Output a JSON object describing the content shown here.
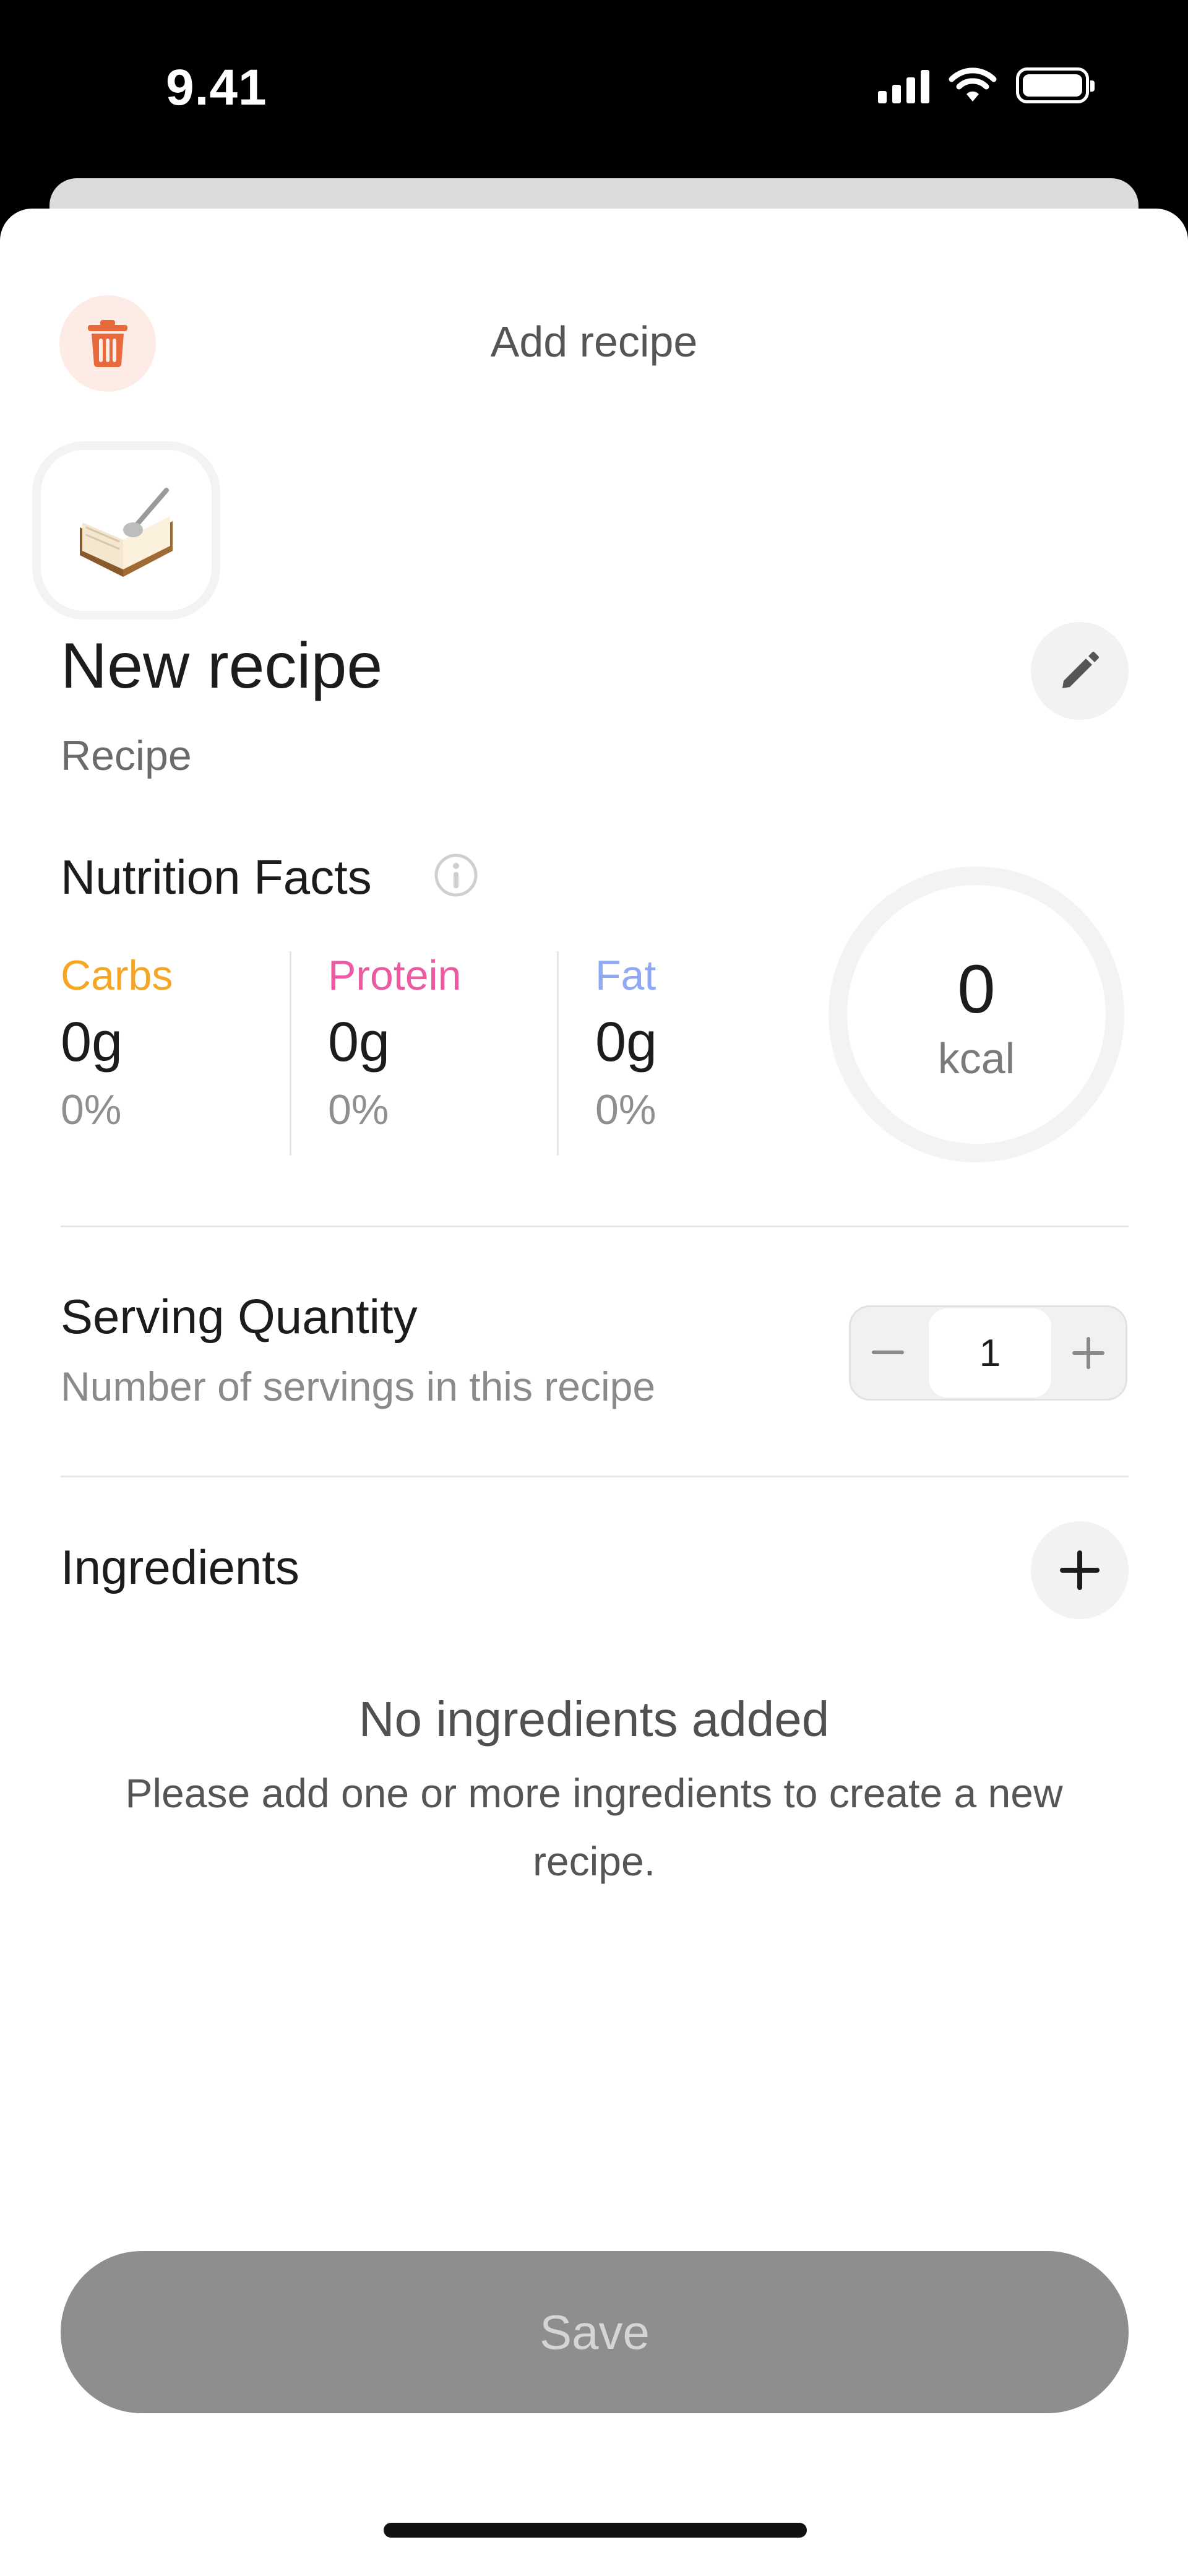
{
  "status_bar": {
    "time": "9.41"
  },
  "header": {
    "title": "Add recipe"
  },
  "recipe": {
    "name": "New recipe",
    "type": "Recipe",
    "icon": "open-book-icon"
  },
  "nutrition": {
    "title": "Nutrition Facts",
    "macros": [
      {
        "label": "Carbs",
        "value": "0g",
        "percent": "0%",
        "color": "#f5a623"
      },
      {
        "label": "Protein",
        "value": "0g",
        "percent": "0%",
        "color": "#ec5ba1"
      },
      {
        "label": "Fat",
        "value": "0g",
        "percent": "0%",
        "color": "#8fa9f5"
      }
    ],
    "kcal_value": "0",
    "kcal_unit": "kcal"
  },
  "serving": {
    "title": "Serving Quantity",
    "subtitle": "Number of servings in this recipe",
    "value": "1"
  },
  "ingredients": {
    "title": "Ingredients",
    "empty_title": "No ingredients added",
    "empty_text": "Please add one or more ingredients to create a new recipe."
  },
  "actions": {
    "save_label": "Save"
  },
  "colors": {
    "accent_delete": "#e8693b",
    "save_disabled": "#8e8e8e"
  }
}
